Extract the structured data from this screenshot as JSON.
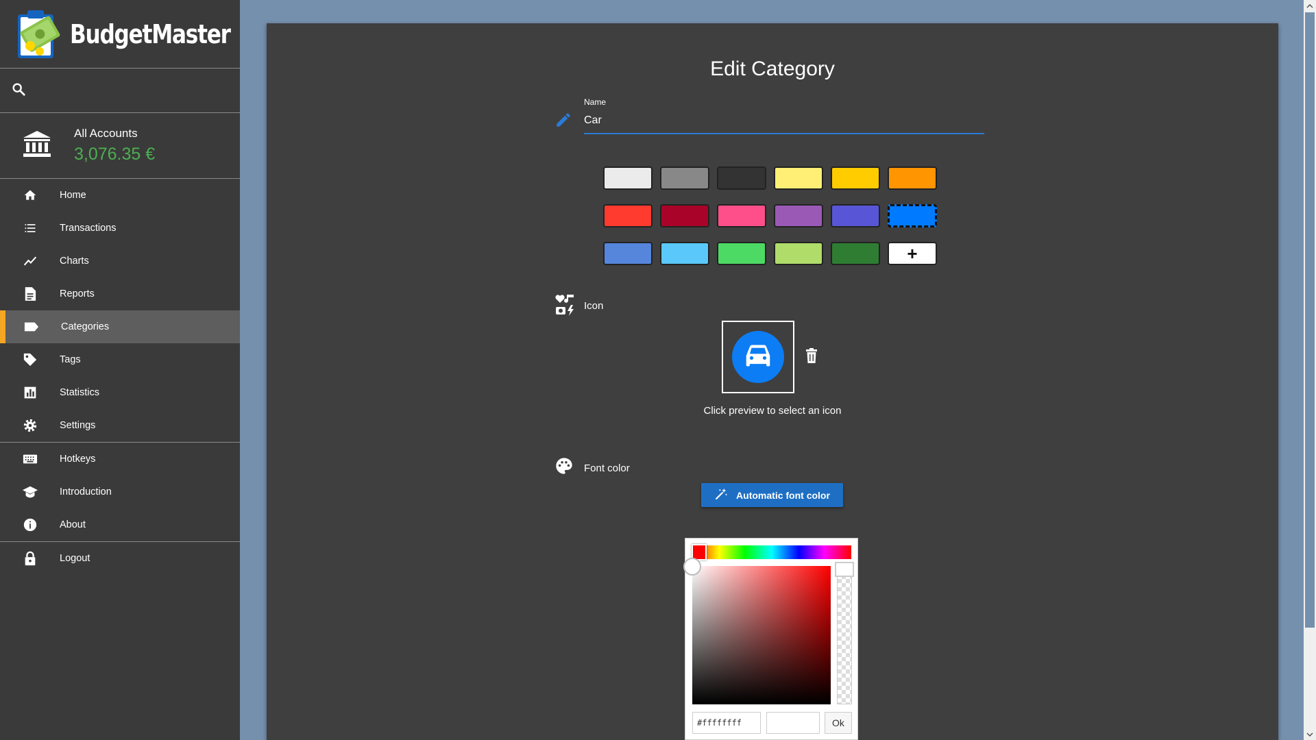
{
  "app": {
    "name": "BudgetMaster"
  },
  "sidebar": {
    "account": {
      "name": "All Accounts",
      "balance": "3,076.35 €"
    },
    "items": [
      {
        "label": "Home",
        "icon": "home-icon"
      },
      {
        "label": "Transactions",
        "icon": "list-icon"
      },
      {
        "label": "Charts",
        "icon": "chart-line-icon"
      },
      {
        "label": "Reports",
        "icon": "document-icon"
      },
      {
        "label": "Categories",
        "icon": "label-icon",
        "active": true
      },
      {
        "label": "Tags",
        "icon": "tag-icon"
      },
      {
        "label": "Statistics",
        "icon": "bar-chart-icon"
      },
      {
        "label": "Settings",
        "icon": "gear-icon"
      },
      {
        "label": "Hotkeys",
        "icon": "keyboard-icon"
      },
      {
        "label": "Introduction",
        "icon": "graduation-cap-icon"
      },
      {
        "label": "About",
        "icon": "info-icon"
      },
      {
        "label": "Logout",
        "icon": "lock-icon"
      }
    ]
  },
  "main": {
    "title": "Edit Category",
    "name_field": {
      "label": "Name",
      "value": "Car"
    },
    "colors": [
      "#ebebeb",
      "#888888",
      "#333333",
      "#fff075",
      "#ffcc00",
      "#ff9500",
      "#ff3b30",
      "#a90329",
      "#ff4f8a",
      "#9b59b6",
      "#5856d6",
      "#007aff",
      "#5586dc",
      "#5ac8fa",
      "#4cd964",
      "#b0dc6a",
      "#2e7d32"
    ],
    "selected_color": "#007aff",
    "add_color_label": "+",
    "icon_section": {
      "label": "Icon",
      "hint": "Click preview to select an icon",
      "preview_icon": "car-icon"
    },
    "font_color_section": {
      "label": "Font color",
      "auto_button_label": "Automatic font color"
    },
    "color_picker": {
      "hex_value": "#ffffffff",
      "ok_label": "Ok"
    }
  }
}
